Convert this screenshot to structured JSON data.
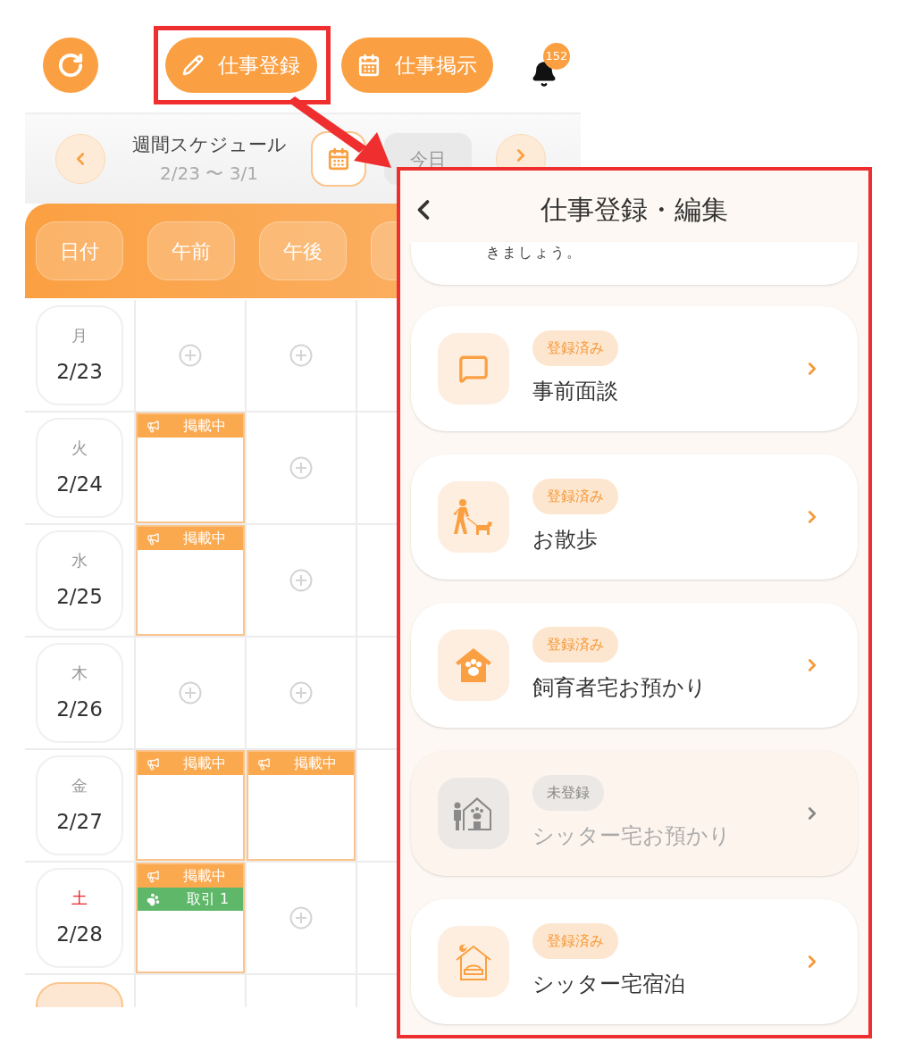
{
  "top_bar": {
    "actions": [
      {
        "kind": "pencil",
        "label": "仕事登録",
        "highlighted": true
      },
      {
        "kind": "calendar",
        "label": "仕事掲示",
        "highlighted": false
      }
    ],
    "notification_count": "152"
  },
  "week_nav": {
    "title": "週間スケジュール",
    "range": "2/23 〜 3/1",
    "today": "今日"
  },
  "schedule": {
    "columns": [
      "日付",
      "午前",
      "午後"
    ],
    "rows": [
      {
        "selected": false,
        "cells": [
          {
            "kind": "date",
            "weekday": "月",
            "date": "2/23",
            "saturday": false
          },
          {
            "kind": "empty"
          },
          {
            "kind": "empty"
          }
        ]
      },
      {
        "selected": false,
        "cells": [
          {
            "kind": "date",
            "weekday": "火",
            "date": "2/24",
            "saturday": false
          },
          {
            "kind": "slot",
            "entries": [
              {
                "kind": "posting",
                "label": "掲載中"
              }
            ]
          },
          {
            "kind": "empty"
          }
        ]
      },
      {
        "selected": false,
        "cells": [
          {
            "kind": "date",
            "weekday": "水",
            "date": "2/25",
            "saturday": false
          },
          {
            "kind": "slot",
            "entries": [
              {
                "kind": "posting",
                "label": "掲載中"
              }
            ]
          },
          {
            "kind": "empty"
          }
        ]
      },
      {
        "selected": false,
        "cells": [
          {
            "kind": "date",
            "weekday": "木",
            "date": "2/26",
            "saturday": false
          },
          {
            "kind": "empty"
          },
          {
            "kind": "empty"
          }
        ]
      },
      {
        "selected": false,
        "cells": [
          {
            "kind": "date",
            "weekday": "金",
            "date": "2/27",
            "saturday": false
          },
          {
            "kind": "slot",
            "entries": [
              {
                "kind": "posting",
                "label": "掲載中"
              }
            ]
          },
          {
            "kind": "slot",
            "entries": [
              {
                "kind": "posting",
                "label": "掲載中"
              }
            ]
          }
        ]
      },
      {
        "selected": false,
        "cells": [
          {
            "kind": "date",
            "weekday": "土",
            "date": "2/28",
            "saturday": true
          },
          {
            "kind": "slot",
            "entries": [
              {
                "kind": "posting",
                "label": "掲載中"
              },
              {
                "kind": "deal",
                "label": "取引 1"
              }
            ]
          },
          {
            "kind": "empty"
          }
        ]
      }
    ]
  },
  "panel": {
    "title": "仕事登録・編集",
    "intro_tail": "きましょう。",
    "services": [
      {
        "kind": "chat",
        "status": "登録済み",
        "registered": true,
        "name": "事前面談"
      },
      {
        "kind": "walk",
        "status": "登録済み",
        "registered": true,
        "name": "お散歩"
      },
      {
        "kind": "home",
        "status": "登録済み",
        "registered": true,
        "name": "飼育者宅お預かり"
      },
      {
        "kind": "sitter_home",
        "status": "未登録",
        "registered": false,
        "name": "シッター宅お預かり"
      },
      {
        "kind": "overnight",
        "status": "登録済み",
        "registered": true,
        "name": "シッター宅宿泊"
      }
    ]
  }
}
